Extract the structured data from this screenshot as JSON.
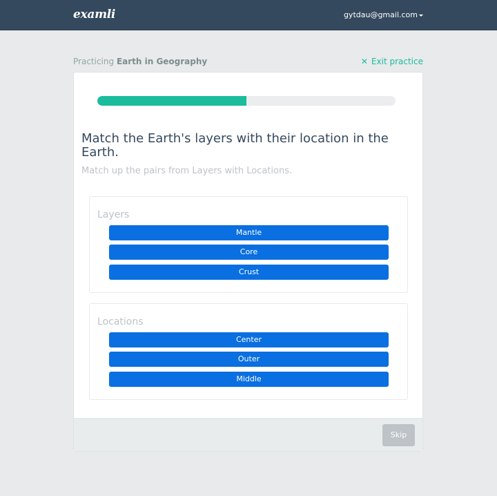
{
  "navbar": {
    "logo": "examli",
    "user_email": "gytdau@gmail.com"
  },
  "practice": {
    "prefix": "Practicing",
    "topic": "Earth in Geography",
    "exit_label": "Exit practice",
    "exit_icon": "close-icon"
  },
  "progress": {
    "fraction": 0.5,
    "color": "#1abc9c"
  },
  "question": {
    "title": "Match the Earth's layers with their location in the Earth.",
    "instructions": "Match up the pairs from Layers with Locations."
  },
  "groups": [
    {
      "title": "Layers",
      "items": [
        "Mantle",
        "Core",
        "Crust"
      ]
    },
    {
      "title": "Locations",
      "items": [
        "Center",
        "Outer",
        "Middle"
      ]
    }
  ],
  "footer": {
    "skip_label": "Skip"
  },
  "colors": {
    "navbar": "#34495e",
    "accent": "#1abc9c",
    "item_button": "#0a6fe0"
  }
}
